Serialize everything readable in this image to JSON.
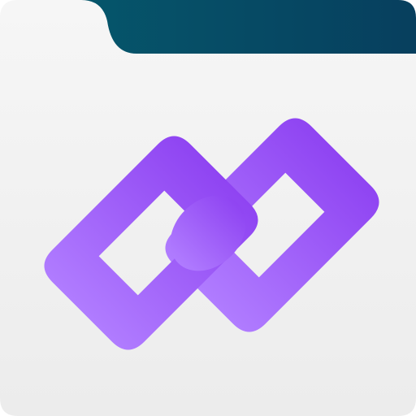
{
  "icon": {
    "name": "linked-folder-icon",
    "folder": {
      "body_color_top": "#f6f6f6",
      "body_color_bottom": "#ececec",
      "tab_color_left": "#05566b",
      "tab_color_right": "#073f5e"
    },
    "link": {
      "icon_name": "chain-link-icon",
      "color_light": "#b07cff",
      "color_dark": "#8f44f2"
    }
  }
}
